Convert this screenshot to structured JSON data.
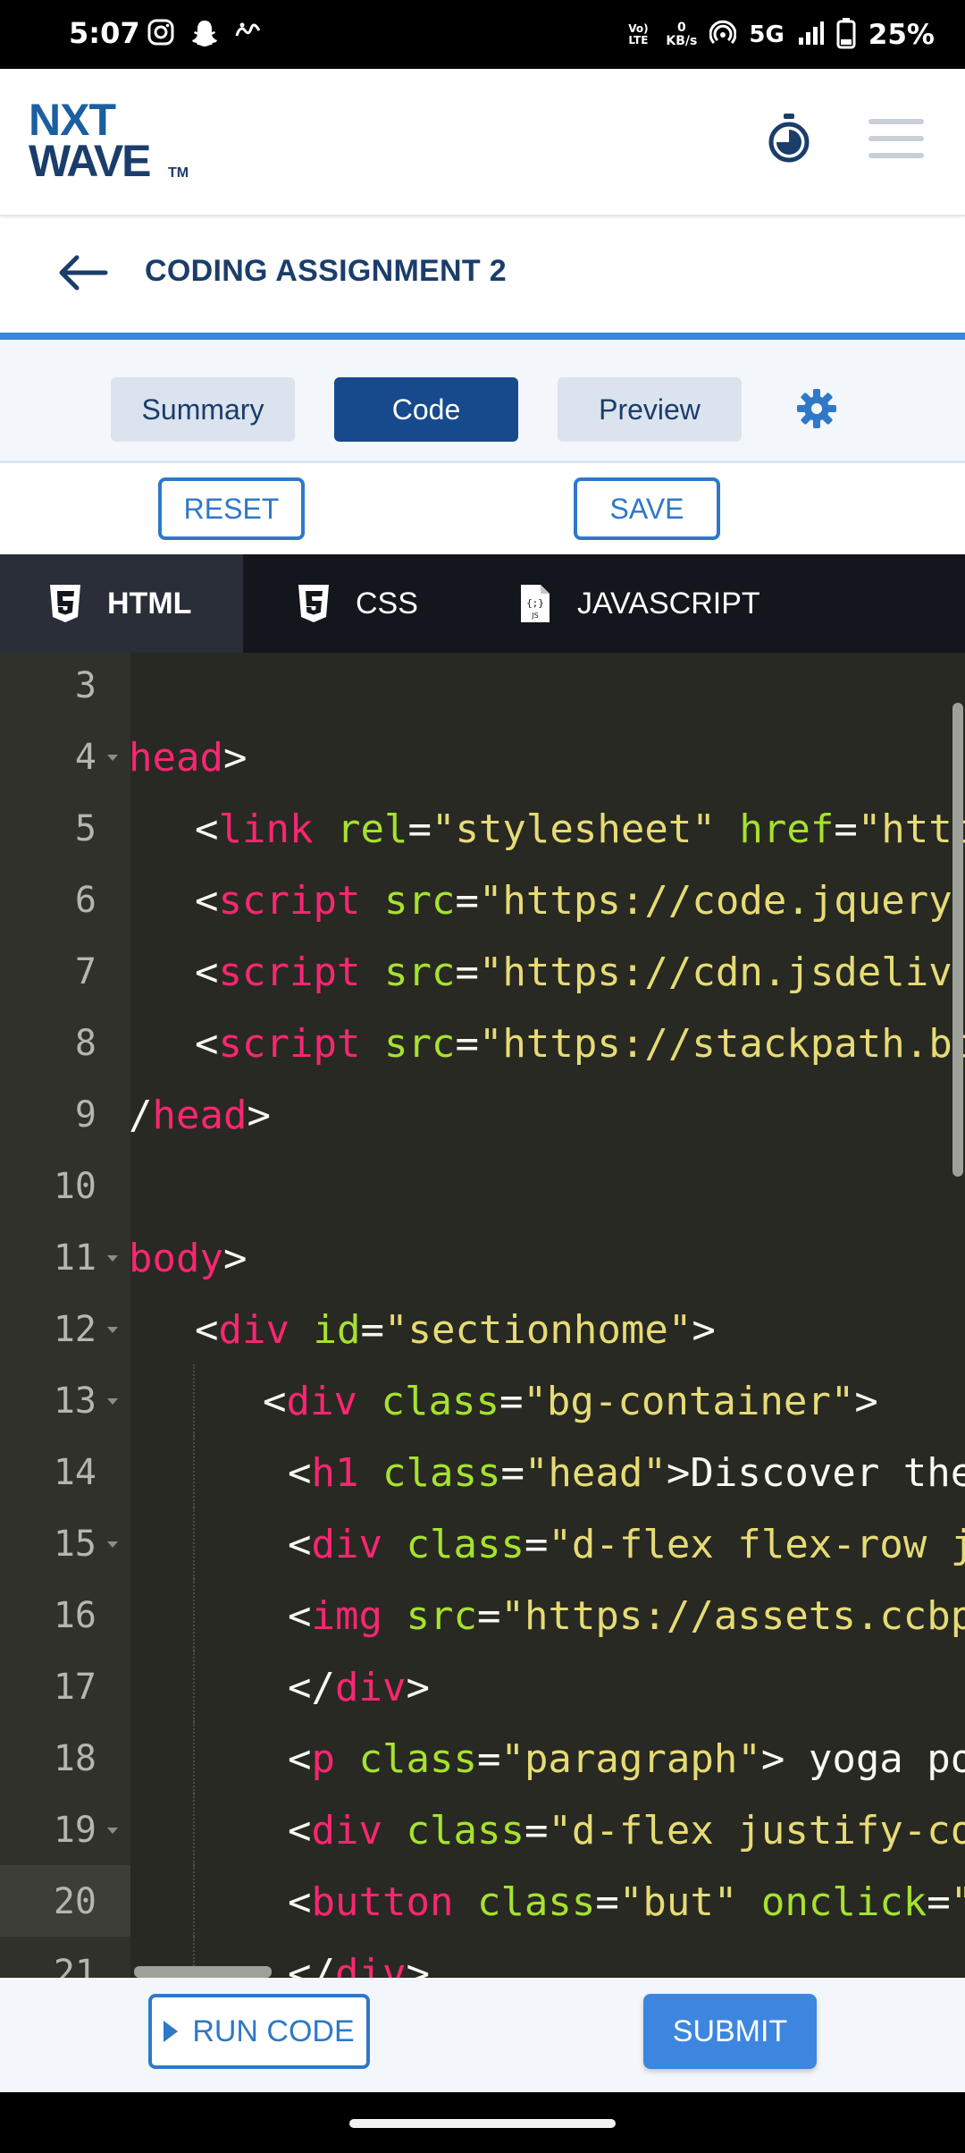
{
  "status_bar": {
    "time": "5:07",
    "network_label": "Vo) LTE",
    "speed_value": "0",
    "speed_unit": "KB/s",
    "network_type": "5G",
    "battery_percent": "25%"
  },
  "header": {
    "logo_top": "NXT",
    "logo_bottom": "WAVE",
    "logo_tm": "TM"
  },
  "title_bar": {
    "title": "CODING ASSIGNMENT 2"
  },
  "view_tabs": {
    "summary": "Summary",
    "code": "Code",
    "preview": "Preview",
    "active": "Code"
  },
  "actions": {
    "reset": "RESET",
    "save": "SAVE"
  },
  "lang_tabs": {
    "html": "HTML",
    "css": "CSS",
    "javascript": "JAVASCRIPT",
    "active": "HTML"
  },
  "editor": {
    "active_line": "20",
    "lines": [
      {
        "num": "3",
        "fold": false,
        "indent": 0,
        "tokens": []
      },
      {
        "num": "4",
        "fold": true,
        "indent": 0,
        "tokens": [
          [
            "t",
            "head"
          ],
          [
            "p",
            ">"
          ]
        ]
      },
      {
        "num": "5",
        "fold": false,
        "indent": 1,
        "tokens": [
          [
            "p",
            "<"
          ],
          [
            "t",
            "link"
          ],
          [
            "p",
            " "
          ],
          [
            "a",
            "rel"
          ],
          [
            "p",
            "="
          ],
          [
            "s",
            "\"stylesheet\""
          ],
          [
            "p",
            " "
          ],
          [
            "a",
            "href"
          ],
          [
            "p",
            "="
          ],
          [
            "s",
            "\"http"
          ]
        ]
      },
      {
        "num": "6",
        "fold": false,
        "indent": 1,
        "tokens": [
          [
            "p",
            "<"
          ],
          [
            "t",
            "script"
          ],
          [
            "p",
            " "
          ],
          [
            "a",
            "src"
          ],
          [
            "p",
            "="
          ],
          [
            "s",
            "\"https://code.jquery"
          ]
        ]
      },
      {
        "num": "7",
        "fold": false,
        "indent": 1,
        "tokens": [
          [
            "p",
            "<"
          ],
          [
            "t",
            "script"
          ],
          [
            "p",
            " "
          ],
          [
            "a",
            "src"
          ],
          [
            "p",
            "="
          ],
          [
            "s",
            "\"https://cdn.jsdeliv"
          ]
        ]
      },
      {
        "num": "8",
        "fold": false,
        "indent": 1,
        "tokens": [
          [
            "p",
            "<"
          ],
          [
            "t",
            "script"
          ],
          [
            "p",
            " "
          ],
          [
            "a",
            "src"
          ],
          [
            "p",
            "="
          ],
          [
            "s",
            "\"https://stackpath.bo"
          ]
        ]
      },
      {
        "num": "9",
        "fold": false,
        "indent": 0,
        "tokens": [
          [
            "p",
            "/"
          ],
          [
            "t",
            "head"
          ],
          [
            "p",
            ">"
          ]
        ]
      },
      {
        "num": "10",
        "fold": false,
        "indent": 0,
        "tokens": []
      },
      {
        "num": "11",
        "fold": true,
        "indent": 0,
        "tokens": [
          [
            "t",
            "body"
          ],
          [
            "p",
            ">"
          ]
        ]
      },
      {
        "num": "12",
        "fold": true,
        "indent": 1,
        "tokens": [
          [
            "p",
            "<"
          ],
          [
            "t",
            "div"
          ],
          [
            "p",
            " "
          ],
          [
            "a",
            "id"
          ],
          [
            "p",
            "="
          ],
          [
            "s",
            "\"sectionhome\""
          ],
          [
            "p",
            ">"
          ]
        ]
      },
      {
        "num": "13",
        "fold": true,
        "indent": 2,
        "tokens": [
          [
            "p",
            "<"
          ],
          [
            "t",
            "div"
          ],
          [
            "p",
            " "
          ],
          [
            "a",
            "class"
          ],
          [
            "p",
            "="
          ],
          [
            "s",
            "\"bg-container\""
          ],
          [
            "p",
            ">"
          ]
        ]
      },
      {
        "num": "14",
        "fold": false,
        "indent": 3,
        "tokens": [
          [
            "p",
            "<"
          ],
          [
            "t",
            "h1"
          ],
          [
            "p",
            " "
          ],
          [
            "a",
            "class"
          ],
          [
            "p",
            "="
          ],
          [
            "s",
            "\"head\""
          ],
          [
            "p",
            ">Discover the"
          ]
        ]
      },
      {
        "num": "15",
        "fold": true,
        "indent": 3,
        "tokens": [
          [
            "p",
            "<"
          ],
          [
            "t",
            "div"
          ],
          [
            "p",
            " "
          ],
          [
            "a",
            "class"
          ],
          [
            "p",
            "="
          ],
          [
            "s",
            "\"d-flex flex-row j"
          ]
        ]
      },
      {
        "num": "16",
        "fold": false,
        "indent": 3,
        "tokens": [
          [
            "p",
            "<"
          ],
          [
            "t",
            "img"
          ],
          [
            "p",
            " "
          ],
          [
            "a",
            "src"
          ],
          [
            "p",
            "="
          ],
          [
            "s",
            "\"https://assets.ccbp"
          ]
        ]
      },
      {
        "num": "17",
        "fold": false,
        "indent": 3,
        "tokens": [
          [
            "p",
            "</"
          ],
          [
            "t",
            "div"
          ],
          [
            "p",
            ">"
          ]
        ]
      },
      {
        "num": "18",
        "fold": false,
        "indent": 3,
        "tokens": [
          [
            "p",
            "<"
          ],
          [
            "t",
            "p"
          ],
          [
            "p",
            " "
          ],
          [
            "a",
            "class"
          ],
          [
            "p",
            "="
          ],
          [
            "s",
            "\"paragraph\""
          ],
          [
            "p",
            "> yoga po"
          ]
        ]
      },
      {
        "num": "19",
        "fold": true,
        "indent": 3,
        "tokens": [
          [
            "p",
            "<"
          ],
          [
            "t",
            "div"
          ],
          [
            "p",
            " "
          ],
          [
            "a",
            "class"
          ],
          [
            "p",
            "="
          ],
          [
            "s",
            "\"d-flex justify-co"
          ]
        ]
      },
      {
        "num": "20",
        "fold": false,
        "indent": 3,
        "tokens": [
          [
            "p",
            "<"
          ],
          [
            "t",
            "button"
          ],
          [
            "p",
            " "
          ],
          [
            "a",
            "class"
          ],
          [
            "p",
            "="
          ],
          [
            "s",
            "\"but\""
          ],
          [
            "p",
            " "
          ],
          [
            "a",
            "onclick"
          ],
          [
            "p",
            "="
          ],
          [
            "s",
            "\""
          ]
        ]
      },
      {
        "num": "21",
        "fold": false,
        "indent": 3,
        "tokens": [
          [
            "p",
            "</"
          ],
          [
            "t",
            "div"
          ],
          [
            "p",
            ">"
          ]
        ]
      }
    ]
  },
  "footer": {
    "run_code": "RUN CODE",
    "submit": "SUBMIT"
  }
}
